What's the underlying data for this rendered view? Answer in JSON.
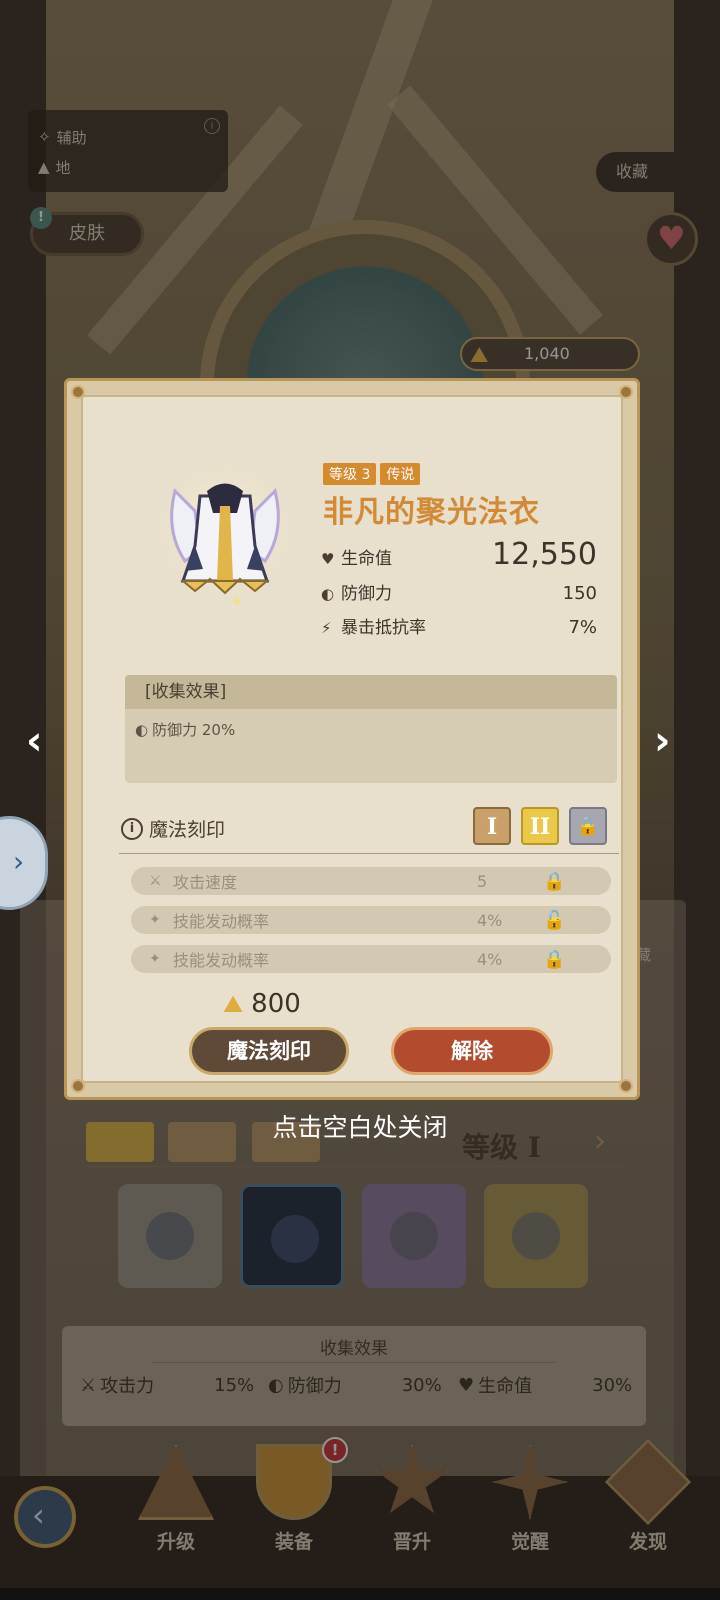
{
  "background": {
    "info_box": {
      "line1": "辅助",
      "line2": "地",
      "info_icon": "info-icon"
    },
    "skin_button": "皮肤",
    "collect_button": "收藏",
    "currency": {
      "amount": "1,040",
      "icon": "gold-pile-icon"
    },
    "stash_label": "藏",
    "level_label": "等级",
    "level_numeral": "I",
    "collect_effect": {
      "title": "收集效果",
      "stats": [
        {
          "icon": "sword-icon",
          "label": "攻击力",
          "value": "15%"
        },
        {
          "icon": "shield-icon",
          "label": "防御力",
          "value": "30%"
        },
        {
          "icon": "heart-icon",
          "label": "生命值",
          "value": "30%"
        }
      ]
    },
    "bottom_nav": [
      {
        "label": "升级"
      },
      {
        "label": "装备",
        "badge": "!"
      },
      {
        "label": "晋升"
      },
      {
        "label": "觉醒"
      },
      {
        "label": "发现"
      }
    ]
  },
  "close_hint": "点击空白处关闭",
  "item": {
    "level_badge": "等级 3",
    "rarity_badge": "传说",
    "name": "非凡的聚光法衣",
    "stats": [
      {
        "icon": "heart-icon",
        "label": "生命值",
        "value": "12,550"
      },
      {
        "icon": "shield-icon",
        "label": "防御力",
        "value": "150"
      },
      {
        "icon": "crit-resist-icon",
        "label": "暴击抵抗率",
        "value": "7%"
      }
    ]
  },
  "collection": {
    "header": "[收集效果]",
    "effect": "防御力 20%"
  },
  "magic_engrave": {
    "title": "魔法刻印",
    "tiers": [
      "I",
      "II"
    ],
    "runes": [
      {
        "label": "攻击速度",
        "value": "5",
        "lock": "locked"
      },
      {
        "label": "技能发动概率",
        "value": "4%",
        "lock": "unlocked"
      },
      {
        "label": "技能发动概率",
        "value": "4%",
        "lock": "locked"
      }
    ]
  },
  "cost": "800",
  "buttons": {
    "engrave": "魔法刻印",
    "release": "解除"
  },
  "colors": {
    "accent_orange": "#d38a36",
    "lock_yellow": "#e6c23a",
    "release_red": "#b34c2e"
  }
}
